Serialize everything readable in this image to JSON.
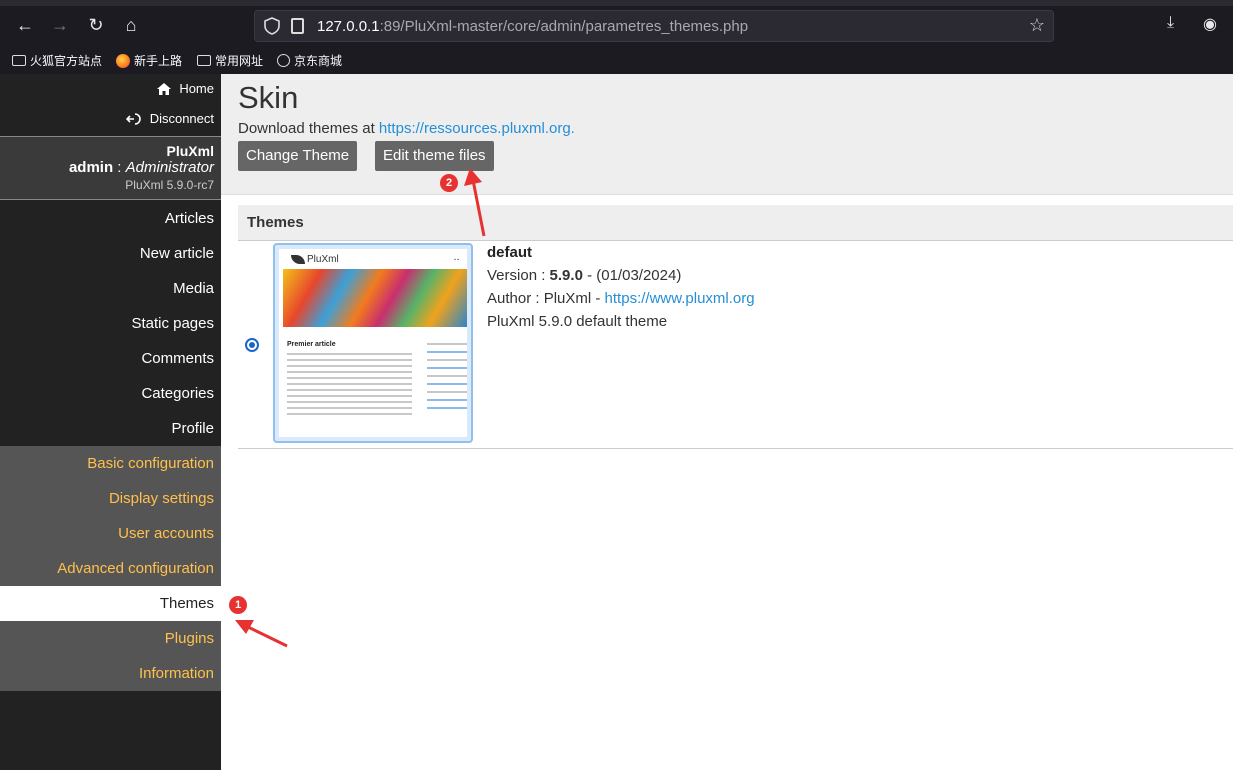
{
  "browser": {
    "url_host": "127.0.0.1",
    "url_port": ":89",
    "url_path": "/PluXml-master/core/admin/parametres_themes.php",
    "bookmarks": [
      "火狐官方站点",
      "新手上路",
      "常用网址",
      "京东商城"
    ]
  },
  "sidebar": {
    "top_links": [
      {
        "label": "Home",
        "icon": "home-icon"
      },
      {
        "label": "Disconnect",
        "icon": "logout-icon"
      }
    ],
    "site_name": "PluXml",
    "user_name": "admin",
    "user_separator": " : ",
    "user_role": "Administrator",
    "version": "PluXml 5.9.0-rc7",
    "menu": {
      "articles": "Articles",
      "new_article": "New article",
      "media": "Media",
      "static_pages": "Static pages",
      "comments": "Comments",
      "categories": "Categories",
      "profile": "Profile",
      "basic_configuration": "Basic configuration",
      "display_settings": "Display settings",
      "user_accounts": "User accounts",
      "advanced_configuration": "Advanced configuration",
      "themes": "Themes",
      "plugins": "Plugins",
      "information": "Information"
    }
  },
  "main": {
    "title": "Skin",
    "download_text": "Download themes at ",
    "download_link": "https://ressources.pluxml.org.",
    "change_theme_label": "Change Theme",
    "edit_theme_files_label": "Edit theme files",
    "table_header": "Themes",
    "theme": {
      "name": "defaut",
      "version_label": "Version : ",
      "version": "5.9.0",
      "date": " - (01/03/2024)",
      "author_label": "Author : PluXml - ",
      "author_link": "https://www.pluxml.org",
      "description": "PluXml 5.9.0 default theme",
      "selected": true,
      "thumbnail": {
        "brand": "PluXml",
        "post_title": "Premier article"
      }
    }
  },
  "annotations": {
    "badge_1": "1",
    "badge_2": "2"
  },
  "colors": {
    "accent_config": "#ffc04d",
    "link": "#258fd6",
    "annotation": "#e83131"
  }
}
